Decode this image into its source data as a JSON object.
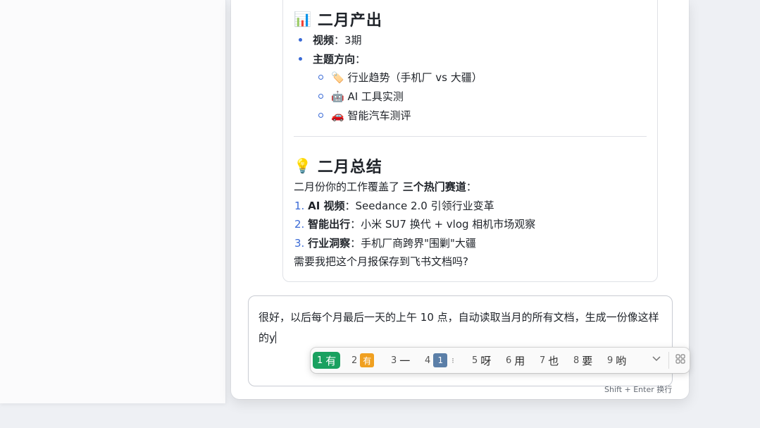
{
  "report": {
    "output_heading": {
      "emoji": "📊",
      "title": "二月产出"
    },
    "video_label": "视频",
    "video_value": "：3期",
    "topics_label": "主题方向",
    "topics_suffix": "：",
    "topics": [
      {
        "emoji": "🏷️",
        "text": "行业趋势（手机厂 vs 大疆）"
      },
      {
        "emoji": "🤖",
        "text": "AI 工具实测"
      },
      {
        "emoji": "🚗",
        "text": "智能汽车测评"
      }
    ],
    "summary_heading": {
      "emoji": "💡",
      "title": "二月总结"
    },
    "summary_intro_a": "二月份你的工作覆盖了 ",
    "summary_intro_b": "三个热门赛道",
    "summary_intro_c": "：",
    "summary_items": [
      {
        "num": "1.",
        "label": "AI 视频",
        "text": "：Seedance 2.0 引领行业变革"
      },
      {
        "num": "2.",
        "label": "智能出行",
        "text": "：小米 SU7 换代 + vlog 相机市场观察"
      },
      {
        "num": "3.",
        "label": "行业洞察",
        "text": "：手机厂商跨界\"围剿\"大疆"
      }
    ],
    "closing": "需要我把这个月报保存到飞书文档吗?"
  },
  "input": {
    "value": "很好，以后每个月最后一天的上午 10 点，自动读取当月的所有文档，生成一份像这样的y",
    "hint": "Shift + Enter 换行"
  },
  "ime": {
    "candidates": [
      {
        "num": "1",
        "text": "有",
        "selected": true
      },
      {
        "num": "2",
        "text": "有",
        "tile": true,
        "tile_color": "#f0a020"
      },
      {
        "num": "3",
        "text": "一"
      },
      {
        "num": "4",
        "text": "1",
        "tile": true,
        "tile_color": "#5b7fa8"
      },
      {
        "num": "5",
        "text": "呀"
      },
      {
        "num": "6",
        "text": "用"
      },
      {
        "num": "7",
        "text": "也"
      },
      {
        "num": "8",
        "text": "要"
      },
      {
        "num": "9",
        "text": "哟"
      }
    ],
    "expand_icon": "chevron-down-icon",
    "grid_icon": "grid-icon"
  }
}
